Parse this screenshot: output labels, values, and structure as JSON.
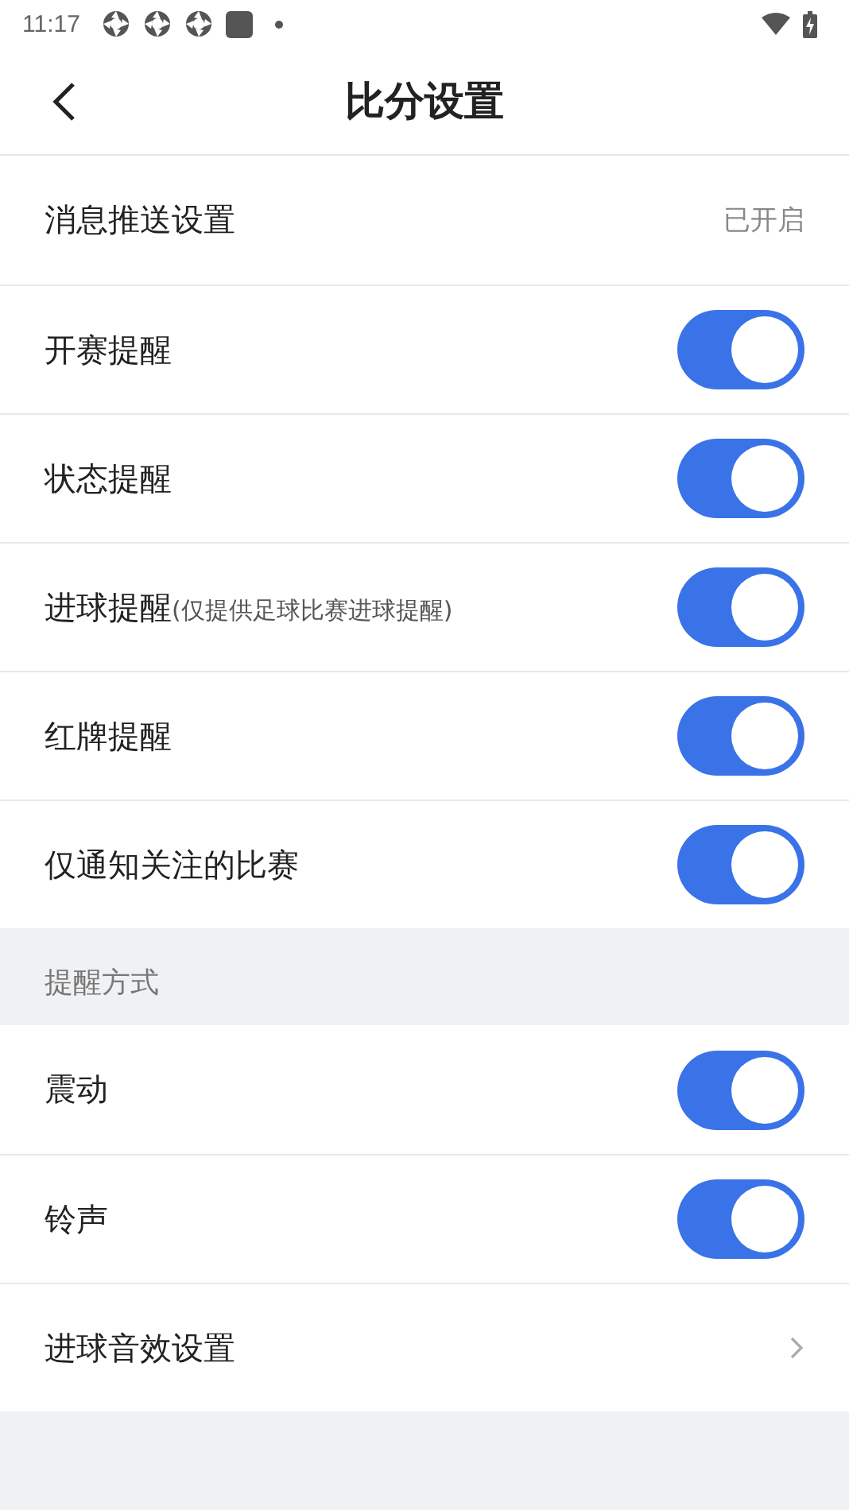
{
  "status_bar": {
    "time": "11:17"
  },
  "header": {
    "title": "比分设置"
  },
  "sections": [
    {
      "rows": [
        {
          "kind": "value",
          "label": "消息推送设置",
          "value": "已开启"
        },
        {
          "kind": "toggle",
          "label": "开赛提醒",
          "on": true
        },
        {
          "kind": "toggle",
          "label": "状态提醒",
          "on": true
        },
        {
          "kind": "toggle",
          "label": "进球提醒",
          "hint": "(仅提供足球比赛进球提醒)",
          "on": true
        },
        {
          "kind": "toggle",
          "label": "红牌提醒",
          "on": true
        },
        {
          "kind": "toggle",
          "label": "仅通知关注的比赛",
          "on": true
        }
      ]
    },
    {
      "title": "提醒方式",
      "rows": [
        {
          "kind": "toggle",
          "label": "震动",
          "on": true
        },
        {
          "kind": "toggle",
          "label": "铃声",
          "on": true
        },
        {
          "kind": "link",
          "label": "进球音效设置"
        }
      ]
    }
  ]
}
